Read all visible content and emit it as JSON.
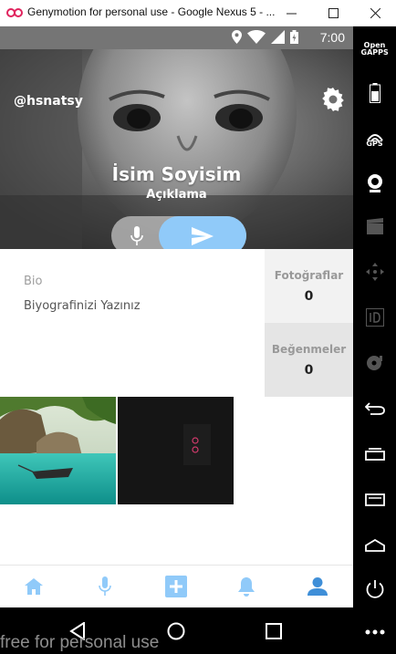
{
  "window": {
    "title": "Genymotion for personal use - Google Nexus 5 - ...",
    "controls": [
      "minimize-icon",
      "maximize-icon",
      "close-icon"
    ]
  },
  "statusbar": {
    "time": "7:00",
    "icons": [
      "location-icon",
      "wifi-icon",
      "signal-icon",
      "battery-icon"
    ]
  },
  "profile": {
    "username": "@hsnatsy",
    "name": "İsim Soyisim",
    "description": "Açıklama",
    "actions": [
      {
        "id": "mic",
        "icon": "mic-icon"
      },
      {
        "id": "send",
        "icon": "send-icon"
      }
    ]
  },
  "bio": {
    "label": "Bio",
    "text": "Biyografinizi Yazınız"
  },
  "stats": [
    {
      "label": "Fotoğraflar",
      "count": "0"
    },
    {
      "label": "Beğenmeler",
      "count": "0"
    }
  ],
  "gallery": [
    {
      "icon": "landscape-photo"
    },
    {
      "icon": "dark-photo"
    }
  ],
  "bottom_nav": {
    "items": [
      "home-icon",
      "mic-icon",
      "add-icon",
      "bell-icon",
      "person-icon"
    ],
    "active_index": 4,
    "active_color": "#3f8fd8",
    "inactive_color": "#90caf9"
  },
  "system_nav": [
    "back-icon",
    "home-circle-icon",
    "recents-icon"
  ],
  "watermark": "free for personal use",
  "toolbar": {
    "opengapps": "Open GAPPS",
    "gps": "GPS",
    "items": [
      "battery-icon",
      "gps-icon",
      "camera-icon",
      "clapper-icon",
      "dpad-icon",
      "id-icon",
      "disk-icon",
      "back-icon",
      "recents-icon",
      "menu-icon",
      "home-icon",
      "power-icon",
      "more-icon"
    ]
  }
}
